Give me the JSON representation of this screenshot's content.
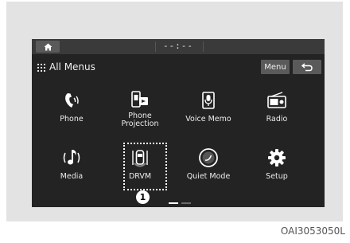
{
  "statusbar": {
    "clock": "--:--"
  },
  "titlebar": {
    "title": "All Menus",
    "menu_label": "Menu"
  },
  "apps": [
    {
      "label": "Phone",
      "icon": "phone-icon"
    },
    {
      "label": "Phone\nProjection",
      "icon": "phone-projection-icon"
    },
    {
      "label": "Voice Memo",
      "icon": "voice-memo-icon"
    },
    {
      "label": "Radio",
      "icon": "radio-icon"
    },
    {
      "label": "Media",
      "icon": "media-icon"
    },
    {
      "label": "DRVM",
      "icon": "drvm-icon"
    },
    {
      "label": "Quiet Mode",
      "icon": "quiet-mode-icon"
    },
    {
      "label": "Setup",
      "icon": "setup-icon"
    }
  ],
  "callout_number": "1",
  "pager": {
    "current": 1,
    "total": 2
  },
  "caption": "OAI3053050L",
  "colors": {
    "screen_bg": "#232323",
    "bar_bg": "#3a3a3a",
    "button_bg": "#5a5a5a",
    "frame_bg": "#e3e3e3"
  }
}
